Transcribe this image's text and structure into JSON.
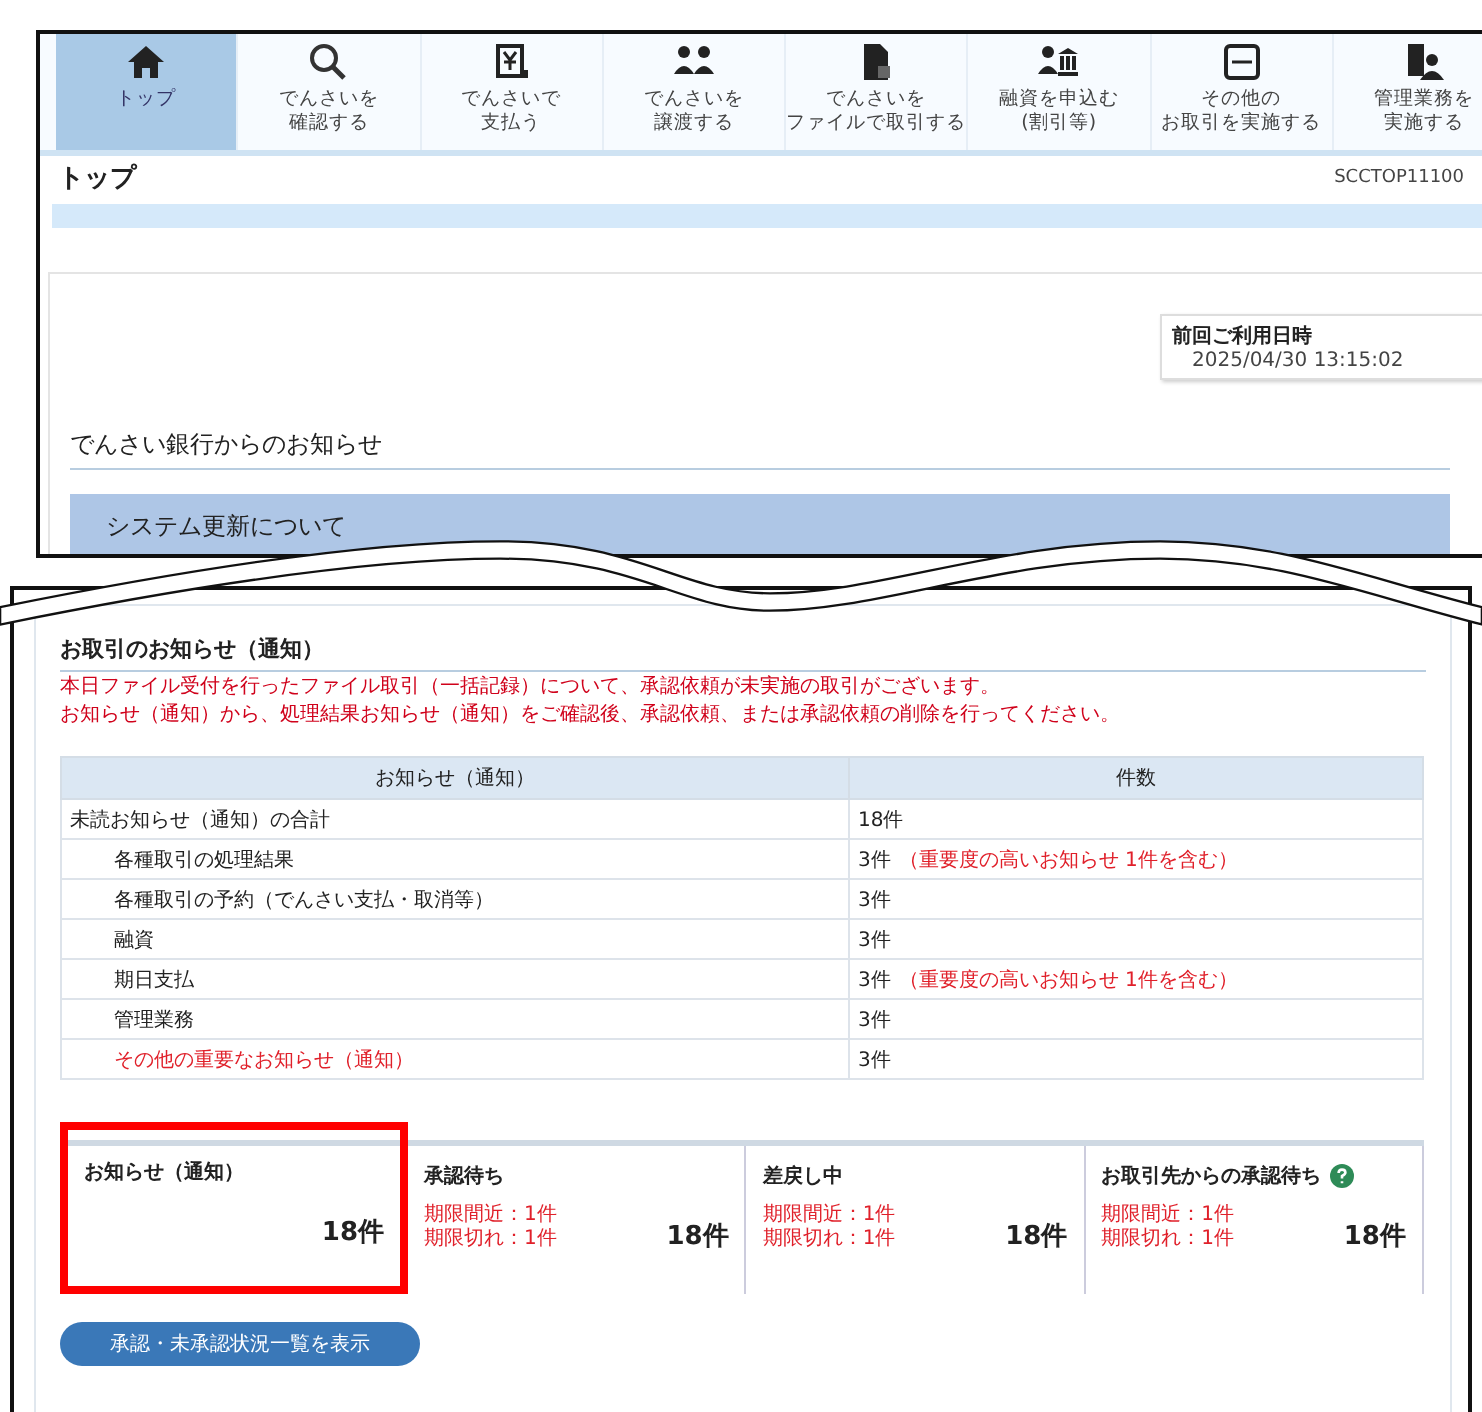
{
  "nav": [
    {
      "kind": "home",
      "label": [
        "トップ"
      ],
      "selected": true
    },
    {
      "kind": "search",
      "label": [
        "でんさいを",
        "確認する"
      ],
      "selected": false
    },
    {
      "kind": "yen",
      "label": [
        "でんさいで",
        "支払う"
      ],
      "selected": false
    },
    {
      "kind": "people",
      "label": [
        "でんさいを",
        "譲渡する"
      ],
      "selected": false
    },
    {
      "kind": "file",
      "label": [
        "でんさいを",
        "ファイルで取引する"
      ],
      "selected": false
    },
    {
      "kind": "bank",
      "label": [
        "融資を申込む",
        "(割引等)"
      ],
      "selected": false
    },
    {
      "kind": "monitor",
      "label": [
        "その他の",
        "お取引を実施する"
      ],
      "selected": false
    },
    {
      "kind": "manager",
      "label": [
        "管理業務を",
        "実施する"
      ],
      "selected": false
    }
  ],
  "page": {
    "title": "トップ",
    "screen_id": "SCCTOP11100"
  },
  "last_login": {
    "label": "前回ご利用日時",
    "value": "2025/04/30 13:15:02"
  },
  "bank_notices": {
    "heading": "でんさい銀行からのお知らせ",
    "items": [
      "システム更新について"
    ]
  },
  "transactions": {
    "heading": "お取引のお知らせ（通知）",
    "warning": [
      "本日ファイル受付を行ったファイル取引（一括記録）について、承認依頼が未実施の取引がございます。",
      "お知らせ（通知）から、処理結果お知らせ（通知）をご確認後、承認依頼、または承認依頼の削除を行ってください。"
    ],
    "columns": [
      "お知らせ（通知）",
      "件数"
    ],
    "rows": [
      {
        "label": "未読お知らせ（通知）の合計",
        "count": "18件",
        "important": false,
        "children": [
          {
            "label": "各種取引の処理結果",
            "count": "3件",
            "note": "（重要度の高いお知らせ 1件を含む）",
            "important": false
          },
          {
            "label": "各種取引の予約（でんさい支払・取消等）",
            "count": "3件",
            "important": false
          },
          {
            "label": "融資",
            "count": "3件",
            "important": false
          },
          {
            "label": "期日支払",
            "count": "3件",
            "note": "（重要度の高いお知らせ 1件を含む）",
            "important": false
          },
          {
            "label": "管理業務",
            "count": "3件",
            "important": false
          },
          {
            "label": "その他の重要なお知らせ（通知）",
            "count": "3件",
            "important": true
          }
        ]
      }
    ],
    "cards": [
      {
        "title": "お知らせ（通知）",
        "count": "18件",
        "highlighted": true,
        "help": false
      },
      {
        "title": "承認待ち",
        "count": "18件",
        "highlighted": false,
        "help": false,
        "lines": [
          "期限間近：1件",
          "期限切れ：1件"
        ]
      },
      {
        "title": "差戻し中",
        "count": "18件",
        "highlighted": false,
        "help": false,
        "lines": [
          "期限間近：1件",
          "期限切れ：1件"
        ]
      },
      {
        "title": "お取引先からの承認待ち",
        "count": "18件",
        "highlighted": false,
        "help": true,
        "lines": [
          "期限間近：1件",
          "期限切れ：1件"
        ]
      }
    ],
    "button": "承認・未承認状況一覧を表示"
  }
}
